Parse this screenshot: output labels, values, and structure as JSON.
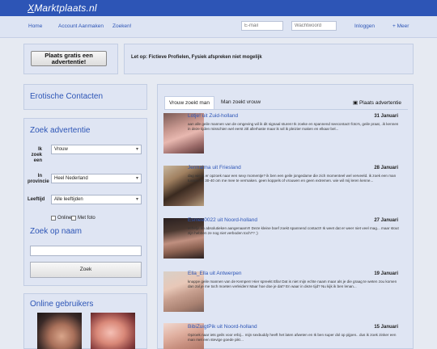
{
  "header": {
    "logo_x": "X",
    "logo_rest": "Marktplaats.nl"
  },
  "nav": {
    "links": [
      "Home",
      "Account Aanmaken",
      "Zoeken!"
    ],
    "email_placeholder": "E-mail",
    "password_placeholder": "Wachtwoord",
    "login": "Inloggen",
    "more": "+ Meer"
  },
  "cta": {
    "label": "Plaats gratis een advertentie!"
  },
  "notice": {
    "text": "Let op: Fictieve Profielen, Fysiek afspreken niet mogelijk"
  },
  "sidebar": {
    "erotic_title": "Erotische Contacten",
    "search_title": "Zoek advertentie",
    "ik_zoek_label": "Ik zoek een",
    "ik_zoek_value": "Vrouw",
    "provincie_label": "In provincie",
    "provincie_value": "Heel Nederland",
    "leeftijd_label": "Leeftijd",
    "leeftijd_value": "Alle leeftijden",
    "online_label": "Online",
    "photo_label": "Met foto",
    "name_title": "Zoek op naam",
    "search_button": "Zoek",
    "online_title": "Online gebruikers"
  },
  "tabs": {
    "active": "Vrouw zoekt man",
    "other": "Man zoekt vrouw",
    "place": "Plaats advertentie"
  },
  "icons": {
    "chevron": "chevron-down-icon",
    "comment": "comment-icon"
  },
  "listings": [
    {
      "name": "Lotje! uit Zuid-holland",
      "date": "31 Januari",
      "text": "aan alle geile mannen van de omgeving wil ik dit signaal sturen! Ik zoeke en spannend seecontact! foto's, geile praat, .ik kennen in deze tijden misschien wel eerst zitl allerhaste maar ik wil ik pleizier maken en elkaar bel..."
    },
    {
      "name": "Jermaima uit Friesland",
      "date": "28 Januari",
      "text": "dag wie is er opzoek naar een sexy momentje? ik ben een geile jongedame die zich momenteel wel verveeld. ik zoek een man tussen de 30-40 om me mee te vermaken. geen koppels of vrouwen en geen extremen. wie wil mij leren kenne..."
    },
    {
      "name": "Esmee0022 uit Noord-holland",
      "date": "27 Januari",
      "text": "echelje en absolutieken aangenaam!!! Deze kleine boef zoekt spannend contact!! Ik weet dat er weer niet veel mag... maar stout zijn hebben ze nog niet verboden toch?? ;)"
    },
    {
      "name": "Ella_Ella uit Antwerpen",
      "date": "19 Januari",
      "text": "knappe geile mannen van de Kempen! Hier spreekt Ella! Dat is niet mijn echte naam maar als je die graag te weten zou komen dan zal je me toch moeten verleiden! Maar hoe doe je dat? En waar in deze tijd? Nu kijk ik ben lenan..."
    },
    {
      "name": "BibiZuigtPik uit Noord-holland",
      "date": "15 Januari",
      "text": "Opzoek naar iets geils voor erbij... mijn sexbuddy heeft het laten afweten en Ik ben super dol op pijpen.. dus ik zoek zinker een man met een stevige goede pik!..."
    }
  ]
}
